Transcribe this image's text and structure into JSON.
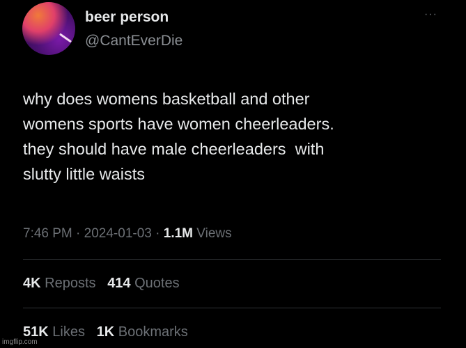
{
  "author": {
    "display_name": "beer person",
    "handle": "@CantEverDie"
  },
  "tweet": {
    "lines": [
      "why does womens basketball and other",
      "womens sports have women cheerleaders.",
      "they should have male cheerleaders  with",
      "slutty little waists"
    ]
  },
  "meta": {
    "time": "7:46 PM",
    "date": "2024-01-03",
    "views_count": "1.1M",
    "views_label": "Views",
    "separator": "·"
  },
  "stats": {
    "reposts_count": "4K",
    "reposts_label": "Reposts",
    "quotes_count": "414",
    "quotes_label": "Quotes",
    "likes_count": "51K",
    "likes_label": "Likes",
    "bookmarks_count": "1K",
    "bookmarks_label": "Bookmarks"
  },
  "more_glyph": "···",
  "watermark": "imgflip.com",
  "colors": {
    "background": "#000000",
    "primary_text": "#e7e9ea",
    "secondary_text": "#6c7075",
    "divider": "#2f3336"
  },
  "icons": {
    "avatar": "profile-avatar",
    "more": "more-options-icon"
  }
}
